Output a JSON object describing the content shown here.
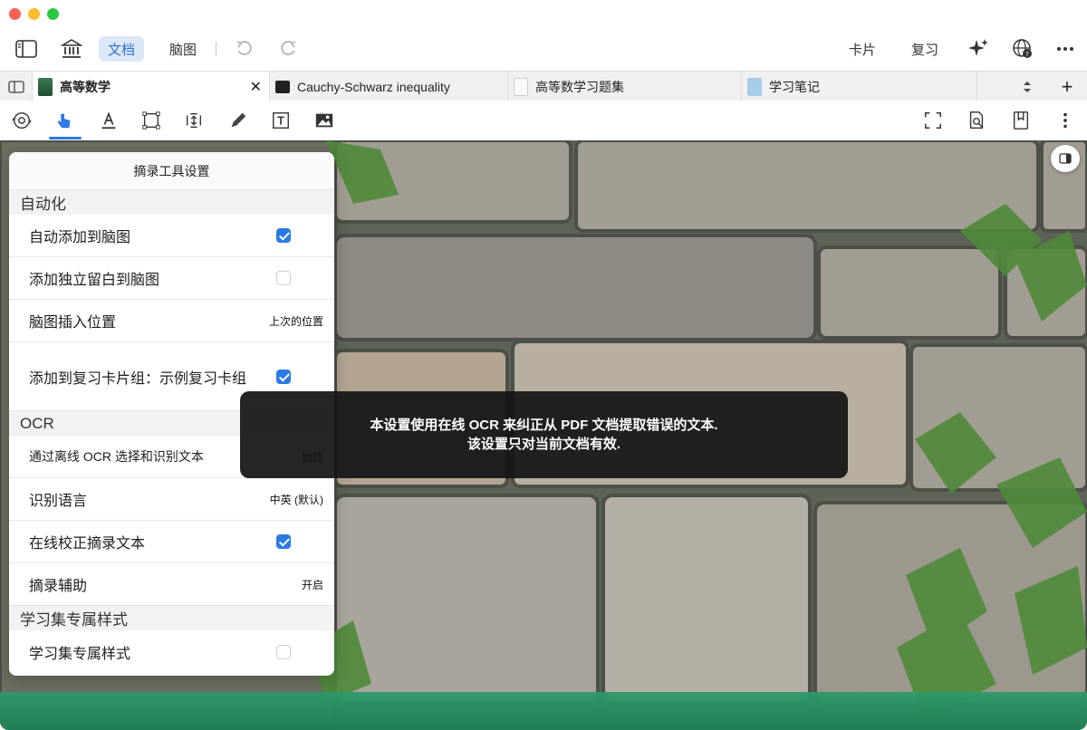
{
  "toolbar": {
    "doc_label": "文档",
    "mindmap_label": "脑图",
    "card_label": "卡片",
    "review_label": "复习"
  },
  "tabs": [
    {
      "label": "高等数学",
      "active": true
    },
    {
      "label": "Cauchy-Schwarz inequality"
    },
    {
      "label": "高等数学习题集"
    },
    {
      "label": "学习笔记"
    }
  ],
  "panel": {
    "title": "摘录工具设置",
    "sections": {
      "automation": "自动化",
      "ocr": "OCR",
      "study_style": "学习集专属样式"
    },
    "rows": {
      "auto_add": "自动添加到脑图",
      "add_blank": "添加独立留白到脑图",
      "insert_pos": "脑图插入位置",
      "insert_pos_val": "上次的位置",
      "add_review": "添加到复习卡片组：示例复习卡组",
      "offline_ocr": "通过离线 OCR 选择和识别文本",
      "offline_ocr_val": "始终",
      "lang": "识别语言",
      "lang_val": "中英 (默认)",
      "online_fix": "在线校正摘录文本",
      "assist": "摘录辅助",
      "assist_val": "开启",
      "study_style_row": "学习集专属样式"
    },
    "checks": {
      "auto_add": true,
      "add_blank": false,
      "add_review": true,
      "online_fix": true,
      "study_style": false
    }
  },
  "toast": {
    "line1": "本设置使用在线 OCR 来纠正从 PDF 文档提取错误的文本.",
    "line2": "该设置只对当前文档有效."
  },
  "colors": {
    "accent": "#2a7ae4",
    "segment_bg": "#dbe8f8"
  }
}
